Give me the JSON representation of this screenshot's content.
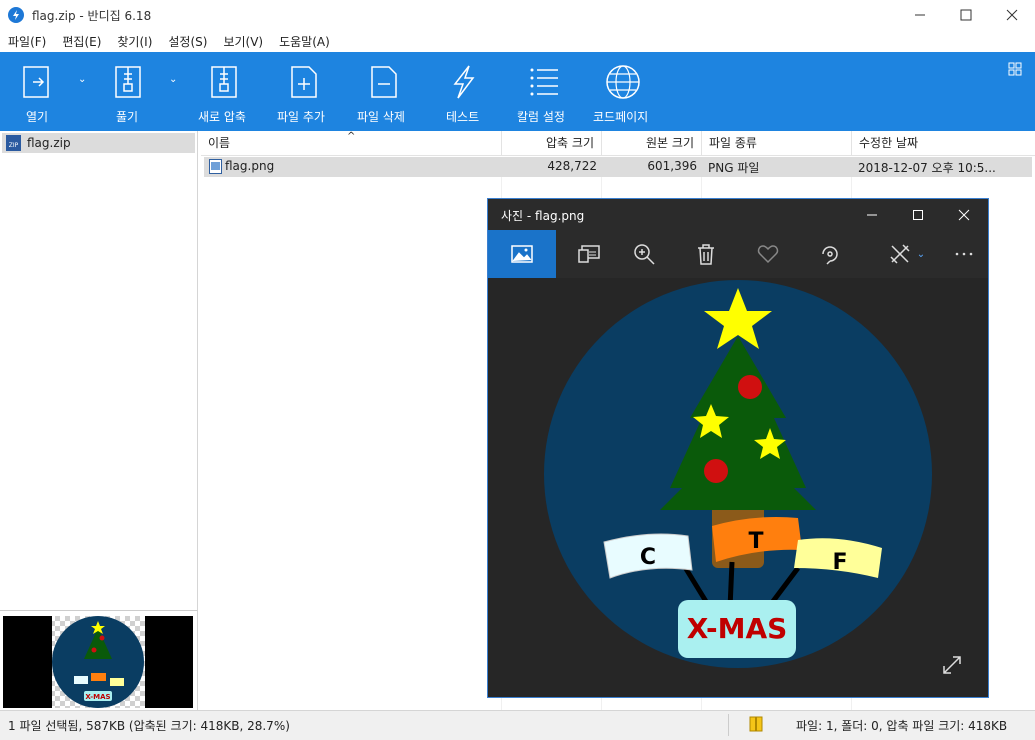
{
  "window": {
    "title": "flag.zip - 반디집 6.18"
  },
  "menu": [
    "파일(F)",
    "편집(E)",
    "찾기(I)",
    "설정(S)",
    "보기(V)",
    "도움말(A)"
  ],
  "toolbar": {
    "open": "열기",
    "extract": "풀기",
    "new_archive": "새로 압축",
    "add_file": "파일 추가",
    "delete_file": "파일 삭제",
    "test": "테스트",
    "column_settings": "칼럼 설정",
    "codepage": "코드페이지"
  },
  "tree": {
    "root": "flag.zip"
  },
  "list": {
    "columns": [
      "이름",
      "압축 크기",
      "원본 크기",
      "파일 종류",
      "수정한 날짜"
    ],
    "rows": [
      {
        "name": "flag.png",
        "compressed": "428,722",
        "original": "601,396",
        "type": "PNG 파일",
        "modified": "2018-12-07 오후 10:5..."
      }
    ]
  },
  "status": {
    "left": "1 파일 선택됨, 587KB (압축된 크기: 418KB, 28.7%)",
    "right": "파일: 1, 폴더: 0, 압축 파일 크기: 418KB"
  },
  "photos": {
    "title": "사진 - flag.png"
  },
  "image": {
    "flag_c": "C",
    "flag_t": "T",
    "flag_f": "F",
    "banner": "X-MAS"
  },
  "colors": {
    "accent": "#1e84e0",
    "photos_bg": "#262626",
    "circle": "#0a3d62",
    "tree": "#0a5a0a"
  }
}
